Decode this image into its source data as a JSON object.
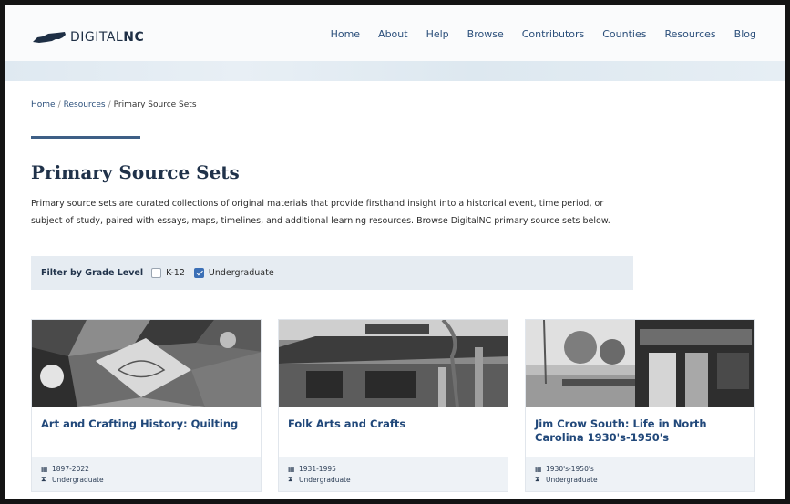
{
  "header": {
    "logo_text_light": "DIGITAL",
    "logo_text_bold": "NC",
    "nav": [
      "Home",
      "About",
      "Help",
      "Browse",
      "Contributors",
      "Counties",
      "Resources",
      "Blog"
    ]
  },
  "breadcrumb": {
    "home": "Home",
    "resources": "Resources",
    "current": "Primary Source Sets",
    "separator": "/"
  },
  "page": {
    "title": "Primary Source Sets",
    "intro": "Primary source sets are curated collections of original materials that provide firsthand insight into a historical event, time period, or subject of study, paired with essays, maps, timelines, and additional learning resources. Browse DigitalNC primary source sets below."
  },
  "filter": {
    "label": "Filter by Grade Level",
    "options": [
      {
        "label": "K-12",
        "checked": false
      },
      {
        "label": "Undergraduate",
        "checked": true
      }
    ]
  },
  "cards": [
    {
      "title": "Art and Crafting History: Quilting",
      "dates": "1897-2022",
      "level": "Undergraduate",
      "image": "quilt-photo"
    },
    {
      "title": "Folk Arts and Crafts",
      "dates": "1931-1995",
      "level": "Undergraduate",
      "image": "storefront-photo"
    },
    {
      "title": "Jim Crow South: Life in North Carolina 1930's-1950's",
      "dates": "1930's-1950's",
      "level": "Undergraduate",
      "image": "theater-street-photo"
    }
  ],
  "icons": {
    "calendar": "calendar-icon",
    "grade": "hourglass-icon"
  },
  "colors": {
    "accent": "#3e5f86",
    "link": "#2a4e7a",
    "title": "#21487a",
    "filter_bg": "#e6ecf2",
    "checkbox_checked": "#3b6fb6"
  }
}
